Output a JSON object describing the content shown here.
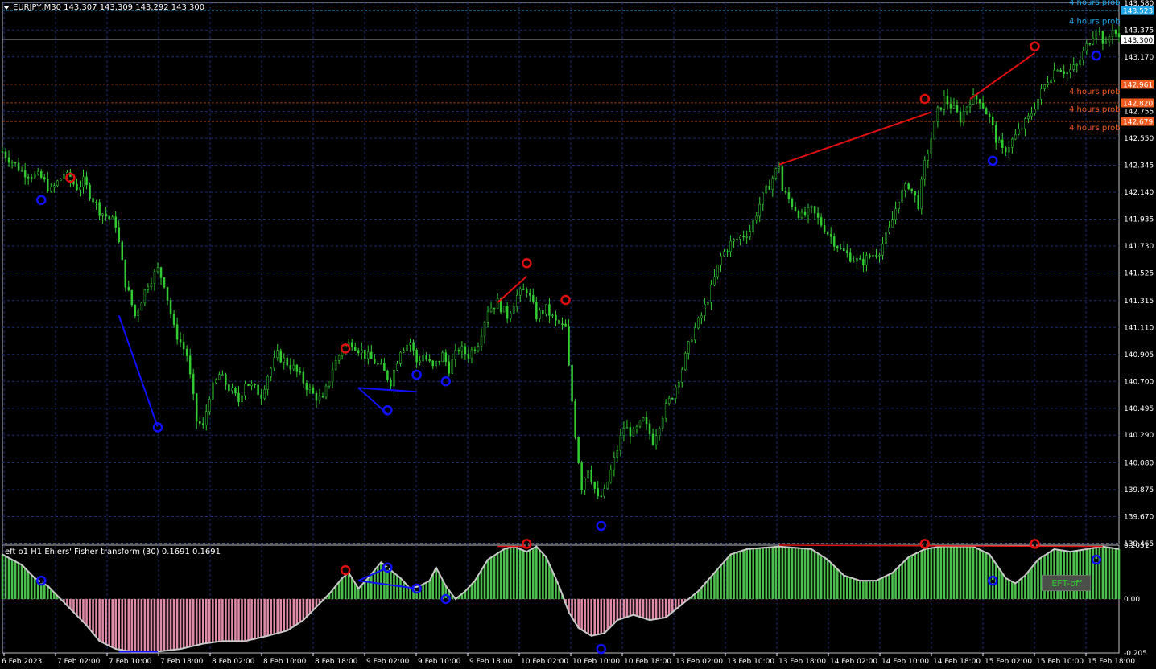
{
  "main_header": {
    "text": "EURJPY,M30  143.307 143.309 143.292 143.300"
  },
  "sub_header": {
    "text": "eft o1 H1 Ehlers' Fisher transform (30) 0.1691 0.1691"
  },
  "ef_button": {
    "label": "EFT-off"
  },
  "price_axis": {
    "ticks": [
      "143.580",
      "143.375",
      "143.170",
      "142.755",
      "142.550",
      "142.345",
      "142.140",
      "141.935",
      "141.730",
      "141.525",
      "141.315",
      "141.110",
      "140.905",
      "140.700",
      "140.495",
      "140.290",
      "140.080",
      "139.875",
      "139.670",
      "139.465"
    ],
    "range": [
      139.465,
      143.585
    ]
  },
  "sub_axis": {
    "ticks": [
      "0.2051",
      "0.00",
      "-0.205"
    ],
    "range": [
      -0.205,
      0.2051
    ]
  },
  "level_tags": [
    {
      "text": "143.523",
      "value": 143.523,
      "color": "#1ea3e6",
      "text_color": "#ffffff"
    },
    {
      "text": "143.300",
      "value": 143.3,
      "color": "#ffffff",
      "text_color": "#000000"
    },
    {
      "text": "142.961",
      "value": 142.961,
      "color": "#f05a1e",
      "text_color": "#ffffff"
    },
    {
      "text": "142.820",
      "value": 142.82,
      "color": "#f05a1e",
      "text_color": "#ffffff"
    },
    {
      "text": "142.679",
      "value": 142.679,
      "color": "#f05a1e",
      "text_color": "#ffffff"
    }
  ],
  "level_labels": [
    {
      "text": "4 hours prob",
      "value": 143.585,
      "color": "#1ea3e6"
    },
    {
      "text": "4 hours prob",
      "value": 143.44,
      "color": "#1ea3e6"
    },
    {
      "text": "4 hours prob",
      "value": 142.905,
      "color": "#f05a1e"
    },
    {
      "text": "4 hours prob",
      "value": 142.77,
      "color": "#f05a1e"
    },
    {
      "text": "4 hours prob",
      "value": 142.63,
      "color": "#f05a1e"
    }
  ],
  "time_axis": {
    "labels": [
      "6 Feb 2023",
      "7 Feb 02:00",
      "7 Feb 10:00",
      "7 Feb 18:00",
      "8 Feb 02:00",
      "8 Feb 10:00",
      "8 Feb 18:00",
      "9 Feb 02:00",
      "9 Feb 10:00",
      "9 Feb 18:00",
      "10 Feb 02:00",
      "10 Feb 10:00",
      "10 Feb 18:00",
      "13 Feb 02:00",
      "13 Feb 10:00",
      "13 Feb 18:00",
      "14 Feb 02:00",
      "14 Feb 10:00",
      "14 Feb 18:00",
      "15 Feb 02:00",
      "15 Feb 10:00",
      "15 Feb 18:00"
    ]
  },
  "colors": {
    "bull": "#32cd32",
    "bear": "#ffffff",
    "grid": "#1c2a6e",
    "up_signal": "#1010ff",
    "down_signal": "#e01010",
    "hist_pos": "#4cc04c",
    "hist_neg": "#e08aa8",
    "fisher_line": "#c8c8c8"
  },
  "chart_data": {
    "type": "candlestick",
    "symbol": "EURJPY",
    "timeframe": "M30",
    "ohlc_last": [
      143.307,
      143.309,
      143.292,
      143.3
    ],
    "price_path": [
      [
        0,
        142.45
      ],
      [
        6,
        142.3
      ],
      [
        12,
        142.25
      ],
      [
        15,
        142.15
      ],
      [
        19,
        142.28
      ],
      [
        23,
        142.18
      ],
      [
        25,
        142.22
      ],
      [
        30,
        142.0
      ],
      [
        35,
        141.9
      ],
      [
        38,
        141.45
      ],
      [
        41,
        141.2
      ],
      [
        45,
        141.45
      ],
      [
        48,
        141.55
      ],
      [
        50,
        141.45
      ],
      [
        53,
        141.1
      ],
      [
        57,
        140.9
      ],
      [
        60,
        140.4
      ],
      [
        62,
        140.35
      ],
      [
        64,
        140.6
      ],
      [
        67,
        140.75
      ],
      [
        70,
        140.65
      ],
      [
        73,
        140.55
      ],
      [
        75,
        140.7
      ],
      [
        80,
        140.6
      ],
      [
        82,
        140.75
      ],
      [
        85,
        140.9
      ],
      [
        90,
        140.8
      ],
      [
        93,
        140.7
      ],
      [
        96,
        140.6
      ],
      [
        99,
        140.55
      ],
      [
        102,
        140.8
      ],
      [
        105,
        140.95
      ],
      [
        108,
        141.0
      ],
      [
        112,
        140.9
      ],
      [
        115,
        140.85
      ],
      [
        117,
        140.8
      ],
      [
        120,
        140.7
      ],
      [
        123,
        140.95
      ],
      [
        126,
        141.0
      ],
      [
        128,
        140.85
      ],
      [
        130,
        140.9
      ],
      [
        133,
        140.8
      ],
      [
        136,
        140.9
      ],
      [
        138,
        140.8
      ],
      [
        141,
        140.95
      ],
      [
        144,
        140.9
      ],
      [
        147,
        141.0
      ],
      [
        150,
        141.25
      ],
      [
        153,
        141.3
      ],
      [
        156,
        141.2
      ],
      [
        159,
        141.35
      ],
      [
        162,
        141.4
      ],
      [
        165,
        141.2
      ],
      [
        168,
        141.25
      ],
      [
        171,
        141.15
      ],
      [
        174,
        141.1
      ],
      [
        175,
        140.8
      ],
      [
        177,
        140.3
      ],
      [
        179,
        139.9
      ],
      [
        181,
        140.05
      ],
      [
        184,
        139.8
      ],
      [
        186,
        139.85
      ],
      [
        189,
        140.1
      ],
      [
        192,
        140.35
      ],
      [
        195,
        140.3
      ],
      [
        198,
        140.4
      ],
      [
        201,
        140.25
      ],
      [
        204,
        140.45
      ],
      [
        207,
        140.6
      ],
      [
        210,
        140.8
      ],
      [
        213,
        141.05
      ],
      [
        216,
        141.2
      ],
      [
        219,
        141.4
      ],
      [
        222,
        141.65
      ],
      [
        225,
        141.75
      ],
      [
        228,
        141.8
      ],
      [
        231,
        141.85
      ],
      [
        234,
        142.05
      ],
      [
        237,
        142.2
      ],
      [
        240,
        142.35
      ],
      [
        241,
        142.15
      ],
      [
        244,
        142.05
      ],
      [
        247,
        141.95
      ],
      [
        250,
        142.0
      ],
      [
        253,
        141.9
      ],
      [
        256,
        141.8
      ],
      [
        259,
        141.7
      ],
      [
        262,
        141.65
      ],
      [
        265,
        141.6
      ],
      [
        268,
        141.65
      ],
      [
        271,
        141.7
      ],
      [
        274,
        141.85
      ],
      [
        277,
        142.1
      ],
      [
        280,
        142.2
      ],
      [
        283,
        142.05
      ],
      [
        285,
        142.35
      ],
      [
        287,
        142.55
      ],
      [
        289,
        142.75
      ],
      [
        291,
        142.85
      ],
      [
        293,
        142.8
      ],
      [
        296,
        142.7
      ],
      [
        299,
        142.85
      ],
      [
        302,
        142.85
      ],
      [
        305,
        142.7
      ],
      [
        307,
        142.55
      ],
      [
        309,
        142.45
      ],
      [
        311,
        142.5
      ],
      [
        314,
        142.6
      ],
      [
        317,
        142.7
      ],
      [
        320,
        142.85
      ],
      [
        323,
        143.0
      ],
      [
        326,
        143.1
      ],
      [
        329,
        143.05
      ],
      [
        332,
        143.1
      ],
      [
        335,
        143.25
      ],
      [
        338,
        143.4
      ],
      [
        341,
        143.25
      ],
      [
        343,
        143.4
      ],
      [
        345,
        143.3
      ]
    ],
    "fisher_path": [
      [
        0,
        0.17
      ],
      [
        6,
        0.13
      ],
      [
        10,
        0.08
      ],
      [
        14,
        0.05
      ],
      [
        18,
        0.0
      ],
      [
        22,
        -0.05
      ],
      [
        26,
        -0.1
      ],
      [
        30,
        -0.16
      ],
      [
        35,
        -0.19
      ],
      [
        40,
        -0.2
      ],
      [
        48,
        -0.2
      ],
      [
        55,
        -0.19
      ],
      [
        62,
        -0.17
      ],
      [
        68,
        -0.16
      ],
      [
        75,
        -0.16
      ],
      [
        82,
        -0.14
      ],
      [
        88,
        -0.12
      ],
      [
        93,
        -0.08
      ],
      [
        97,
        -0.03
      ],
      [
        101,
        0.02
      ],
      [
        105,
        0.08
      ],
      [
        107,
        0.1
      ],
      [
        110,
        0.04
      ],
      [
        113,
        0.08
      ],
      [
        117,
        0.14
      ],
      [
        120,
        0.11
      ],
      [
        123,
        0.08
      ],
      [
        126,
        0.04
      ],
      [
        129,
        0.05
      ],
      [
        132,
        0.07
      ],
      [
        134,
        0.12
      ],
      [
        137,
        0.05
      ],
      [
        140,
        0.0
      ],
      [
        143,
        0.03
      ],
      [
        146,
        0.07
      ],
      [
        150,
        0.15
      ],
      [
        155,
        0.19
      ],
      [
        158,
        0.2
      ],
      [
        162,
        0.18
      ],
      [
        165,
        0.2
      ],
      [
        168,
        0.16
      ],
      [
        172,
        0.05
      ],
      [
        175,
        -0.05
      ],
      [
        178,
        -0.11
      ],
      [
        182,
        -0.14
      ],
      [
        186,
        -0.13
      ],
      [
        190,
        -0.08
      ],
      [
        195,
        -0.06
      ],
      [
        200,
        -0.08
      ],
      [
        205,
        -0.07
      ],
      [
        210,
        -0.02
      ],
      [
        215,
        0.03
      ],
      [
        220,
        0.1
      ],
      [
        225,
        0.17
      ],
      [
        230,
        0.19
      ],
      [
        240,
        0.2
      ],
      [
        250,
        0.19
      ],
      [
        255,
        0.15
      ],
      [
        260,
        0.09
      ],
      [
        265,
        0.07
      ],
      [
        270,
        0.07
      ],
      [
        275,
        0.1
      ],
      [
        280,
        0.16
      ],
      [
        285,
        0.19
      ],
      [
        290,
        0.2
      ],
      [
        300,
        0.2
      ],
      [
        305,
        0.17
      ],
      [
        310,
        0.08
      ],
      [
        313,
        0.06
      ],
      [
        316,
        0.09
      ],
      [
        320,
        0.15
      ],
      [
        325,
        0.19
      ],
      [
        330,
        0.18
      ],
      [
        335,
        0.19
      ],
      [
        340,
        0.2
      ],
      [
        345,
        0.19
      ]
    ],
    "up_signals": [
      [
        12,
        142.08
      ],
      [
        48,
        140.35
      ],
      [
        119,
        140.48
      ],
      [
        128,
        140.75
      ],
      [
        137,
        140.7
      ],
      [
        185,
        139.6
      ],
      [
        306,
        142.38
      ],
      [
        338,
        143.18
      ]
    ],
    "down_signals": [
      [
        21,
        142.25
      ],
      [
        106,
        140.95
      ],
      [
        162,
        141.6
      ],
      [
        174,
        141.32
      ],
      [
        285,
        142.85
      ],
      [
        319,
        143.25
      ]
    ],
    "sub_up_signals": [
      [
        12,
        0.07
      ],
      [
        119,
        0.12
      ],
      [
        128,
        0.04
      ],
      [
        137,
        0.0
      ],
      [
        185,
        -0.19
      ],
      [
        306,
        0.07
      ],
      [
        338,
        0.15
      ]
    ],
    "sub_down_signals": [
      [
        106,
        0.11
      ],
      [
        162,
        0.21
      ],
      [
        285,
        0.21
      ],
      [
        319,
        0.21
      ]
    ],
    "resistance_lines": [
      [
        153,
        141.3,
        162,
        141.5
      ],
      [
        240,
        142.35,
        287,
        142.75
      ],
      [
        299,
        142.85,
        319,
        143.2
      ]
    ],
    "support_lines": [
      [
        36,
        141.2,
        48,
        140.35
      ],
      [
        110,
        140.65,
        119,
        140.45
      ],
      [
        110,
        140.65,
        128,
        140.62
      ]
    ]
  }
}
